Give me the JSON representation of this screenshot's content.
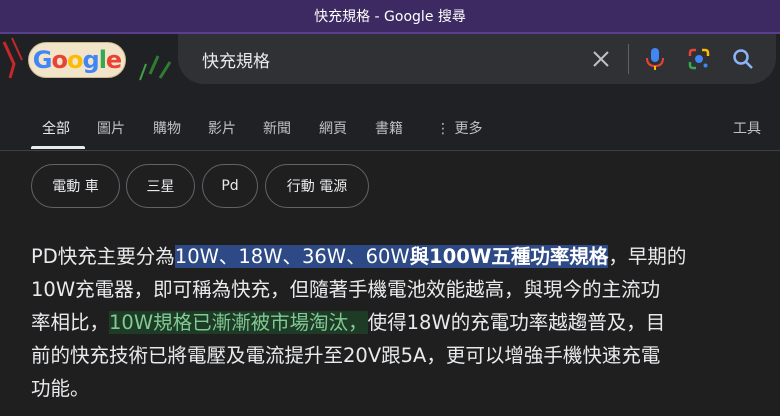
{
  "window": {
    "title": "快充規格 - Google 搜尋"
  },
  "doodle": {
    "letters": [
      "G",
      "o",
      "o",
      "g",
      "l",
      "e"
    ]
  },
  "search": {
    "query": "快充規格"
  },
  "icons": {
    "clear": "close-icon",
    "mic": "microphone-icon",
    "lens": "google-lens-icon",
    "search": "search-icon"
  },
  "tabs": [
    {
      "label": "全部",
      "active": true
    },
    {
      "label": "圖片"
    },
    {
      "label": "購物"
    },
    {
      "label": "影片"
    },
    {
      "label": "新聞"
    },
    {
      "label": "網頁"
    },
    {
      "label": "書籍"
    },
    {
      "label": "更多"
    }
  ],
  "tools_label": "工具",
  "chips": [
    "電動 車",
    "三星",
    "Pd",
    "行動 電源"
  ],
  "snippet": {
    "line1_pre": "PD快充主要分為",
    "line1_hl": "10W、18W、36W、60W",
    "line1_hl_bold": "與100W五種功率規格",
    "line1_post": "，早期的",
    "line2": "10W充電器，即可稱為快充，但隨著手機電池效能越高，與現今的主流功",
    "line3_pre": "率相比，",
    "line3_hl": "10W規格已漸漸被市場淘汰，",
    "line3_post": "使得18W的充電功率越趨普及，目",
    "line4": "前的快充技術已將電壓及電流提升至20V跟5A，更可以增強手機快速充電",
    "line5": "功能。"
  },
  "colors": {
    "title_bar": "#3d2a63",
    "background": "#1f1f1f",
    "highlight_blue": "#2e4a86",
    "highlight_green": "#1e3b26",
    "highlight_green_text": "#81c995"
  }
}
